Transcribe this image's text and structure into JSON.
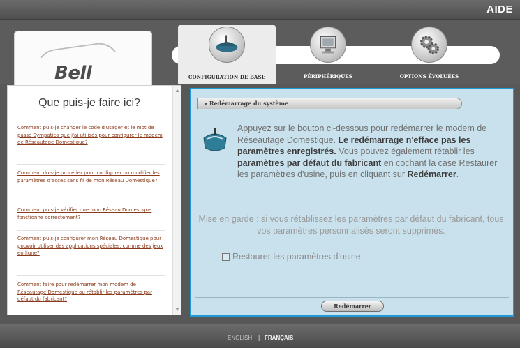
{
  "topbar": {
    "help_label": "AIDE"
  },
  "header": {
    "logo_text": "Bell",
    "tabs": [
      {
        "label": "CONFIGURATION DE BASE",
        "icon": "router-icon",
        "active": true
      },
      {
        "label": "PÉRIPHÉRIQUES",
        "icon": "monitor-icon",
        "active": false
      },
      {
        "label": "OPTIONS ÉVOLUÉES",
        "icon": "gears-icon",
        "active": false
      }
    ]
  },
  "sidebar": {
    "title": "Que puis-je faire ici?",
    "faqs": [
      "Comment puis-je changer le code d'usager et le mot de passe Sympatico que j'ai utilisés pour configurer le modem de Réseautage Domestique?",
      "Comment dois-je procéder pour configurer ou modifier les paramètres d'accès sans fil de mon Réseau Domestique?",
      "Comment puis-je vérifier que mon Réseau Domestique fonctionne correctement?",
      "Comment puis-je configurer mon Réseau Domestique pour pouvoir utiliser des applications spéciales, comme des jeux en ligne?",
      "Comment faire pour redémarrer mon modem de Réseautage Domestique ou rétablir les paramètres par défaut du fabricant?"
    ]
  },
  "main": {
    "section_title": "Redémarrage du système",
    "description_parts": {
      "p1": "Appuyez sur le bouton ci-dessous pour redémarrer le modem de Réseautage Domestique. ",
      "b1": "Le redémarrage n'efface pas les paramètres enregistrés.",
      "p2": " Vous pouvez également rétablir les ",
      "b2": "paramètres par défaut du fabricant",
      "p3": " en cochant la case Restaurer les paramètres d'usine, puis en cliquant sur ",
      "b3": "Redémarrer",
      "p4": "."
    },
    "warning": "Mise en garde : si vous rétablissez les paramètres par défaut du fabricant, tous vos paramètres personnalisés seront supprimés.",
    "checkbox_label": "Restaurer les paramètres d'usine.",
    "checkbox_checked": false,
    "restart_button": "Redémarrer"
  },
  "footer": {
    "lang_english": "ENGLISH",
    "separator": "|",
    "lang_french": "FRANÇAIS"
  },
  "colors": {
    "accent_border": "#1d9bd6",
    "panel_bg": "#c8e1ec",
    "chrome": "#585858"
  }
}
